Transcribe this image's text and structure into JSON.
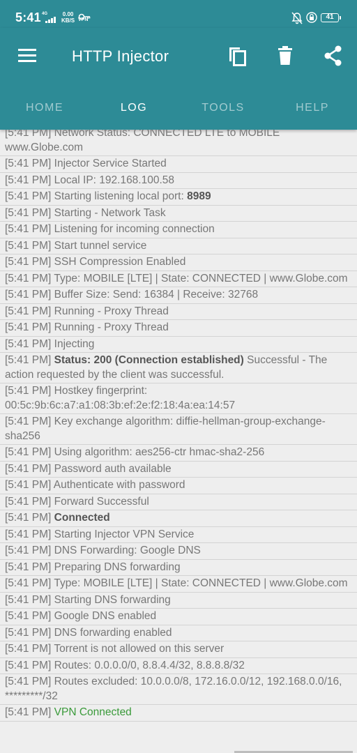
{
  "status_bar": {
    "time": "5:41",
    "network_label": "4G",
    "speed_value": "0.00",
    "speed_unit": "KB/S",
    "vpn_label": "VPN",
    "battery": "41"
  },
  "app_bar": {
    "title": "HTTP Injector",
    "icons": [
      "menu-icon",
      "copy-icon",
      "trash-icon",
      "share-icon"
    ]
  },
  "tabs": [
    {
      "label": "HOME",
      "active": false
    },
    {
      "label": "LOG",
      "active": true
    },
    {
      "label": "TOOLS",
      "active": false
    },
    {
      "label": "HELP",
      "active": false
    }
  ],
  "colors": {
    "primary": "#2d8b96",
    "background": "#eeeeee",
    "log_text": "#777777",
    "success_green": "#3a9a3a"
  },
  "log": [
    {
      "time": "[5:41 PM]",
      "text": "Network Status: CONNECTED LTE to MOBILE www.Globe.com"
    },
    {
      "time": "[5:41 PM]",
      "text": "Injector Service Started"
    },
    {
      "time": "[5:41 PM]",
      "text": "Local IP: 192.168.100.58"
    },
    {
      "time": "[5:41 PM]",
      "text": "Starting listening local port:",
      "highlight": "8989",
      "suffix": ""
    },
    {
      "time": "[5:41 PM]",
      "text": "Starting - Network Task"
    },
    {
      "time": "[5:41 PM]",
      "text": "Listening for incoming connection"
    },
    {
      "time": "[5:41 PM]",
      "text": "Start tunnel service"
    },
    {
      "time": "[5:41 PM]",
      "text": "SSH Compression Enabled"
    },
    {
      "time": "[5:41 PM]",
      "text": "Type: MOBILE [LTE] | State: CONNECTED | www.Globe.com"
    },
    {
      "time": "[5:41 PM]",
      "text": "Buffer Size: Send: 16384 | Receive: 32768"
    },
    {
      "time": "[5:41 PM]",
      "text": "Running - Proxy Thread"
    },
    {
      "time": "[5:41 PM]",
      "text": "Running - Proxy Thread"
    },
    {
      "time": "[5:41 PM]",
      "text": "Injecting"
    },
    {
      "time": "[5:41 PM]",
      "text": "",
      "highlight": "Status: 200 (Connection established)",
      "suffix": "Successful - The action requested by the client was successful."
    },
    {
      "time": "[5:41 PM]",
      "text": "Hostkey fingerprint: 00:5c:9b:6c:a7:a1:08:3b:ef:2e:f2:18:4a:ea:14:57"
    },
    {
      "time": "[5:41 PM]",
      "text": "Key exchange algorithm: diffie-hellman-group-exchange-sha256"
    },
    {
      "time": "[5:41 PM]",
      "text": "Using algorithm: aes256-ctr hmac-sha2-256"
    },
    {
      "time": "[5:41 PM]",
      "text": "Password auth available"
    },
    {
      "time": "[5:41 PM]",
      "text": "Authenticate with password"
    },
    {
      "time": "[5:41 PM]",
      "text": "Forward Successful"
    },
    {
      "time": "[5:41 PM]",
      "text": "",
      "highlight": "Connected",
      "suffix": ""
    },
    {
      "time": "[5:41 PM]",
      "text": "Starting Injector VPN Service"
    },
    {
      "time": "[5:41 PM]",
      "text": "DNS Forwarding: Google DNS"
    },
    {
      "time": "[5:41 PM]",
      "text": "Preparing DNS forwarding"
    },
    {
      "time": "[5:41 PM]",
      "text": "Type: MOBILE [LTE] | State: CONNECTED | www.Globe.com"
    },
    {
      "time": "[5:41 PM]",
      "text": "Starting DNS forwarding"
    },
    {
      "time": "[5:41 PM]",
      "text": "Google DNS enabled"
    },
    {
      "time": "[5:41 PM]",
      "text": "DNS forwarding enabled"
    },
    {
      "time": "[5:41 PM]",
      "text": "Torrent is not allowed on this server"
    },
    {
      "time": "[5:41 PM]",
      "text": "Routes: 0.0.0.0/0, 8.8.4.4/32, 8.8.8.8/32"
    },
    {
      "time": "[5:41 PM]",
      "text": "Routes excluded: 10.0.0.0/8, 172.16.0.0/12, 192.168.0.0/16, *********/32"
    },
    {
      "time": "[5:41 PM]",
      "text": "",
      "green": "VPN Connected"
    }
  ]
}
